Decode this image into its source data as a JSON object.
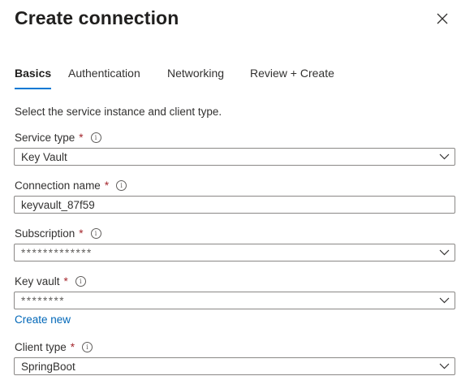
{
  "title": "Create connection",
  "tabs": [
    {
      "label": "Basics",
      "active": true
    },
    {
      "label": "Authentication"
    },
    {
      "label": "Networking"
    },
    {
      "label": "Review + Create"
    }
  ],
  "description": "Select the service instance and client type.",
  "required_marker": "*",
  "info_glyph": "i",
  "fields": {
    "service_type": {
      "label": "Service type",
      "value": "Key Vault"
    },
    "connection_name": {
      "label": "Connection name",
      "value": "keyvault_87f59"
    },
    "subscription": {
      "label": "Subscription",
      "value": "*************"
    },
    "key_vault": {
      "label": "Key vault",
      "value": "********"
    },
    "client_type": {
      "label": "Client type",
      "value": "SpringBoot"
    }
  },
  "create_new_link": "Create new",
  "colors": {
    "accent": "#0078d4",
    "required": "#a4262c",
    "link": "#0067b8"
  }
}
